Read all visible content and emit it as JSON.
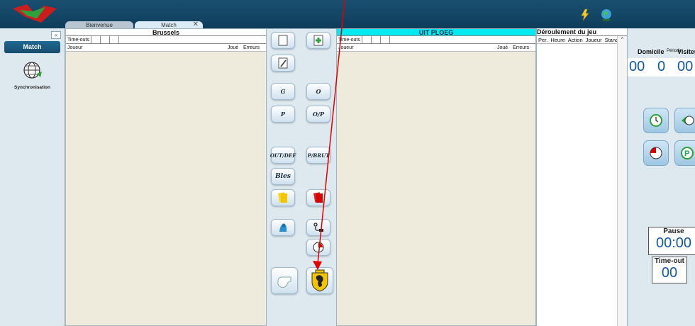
{
  "window": {
    "tabs": [
      {
        "label": "Bienvenue"
      },
      {
        "label": "Match",
        "close": "✕"
      }
    ],
    "top_icons": [
      "lightning-icon",
      "globe-icon"
    ]
  },
  "sidebar": {
    "collapse": "«",
    "active_item": "Match",
    "items": [
      {
        "label": "Synchronisation",
        "icon": "globe-sync-icon"
      }
    ]
  },
  "team_home": {
    "name": "Brussels",
    "timeouts_label": "Time-outs",
    "col_player": "Joueur",
    "col_played": "Joué",
    "col_errors": "Erreurs"
  },
  "team_away": {
    "name": "UIT PLOEG",
    "timeouts_label": "Time-outs",
    "col_player": "Joueur",
    "col_played": "Joué",
    "col_errors": "Erreurs",
    "accent": "#00eaf2"
  },
  "actions": {
    "g": "G",
    "o": "O",
    "p": "P",
    "op": "O/P",
    "outdef": "OUT/DEF",
    "pbrut": "P/BRUT",
    "bles": "Bles"
  },
  "events": {
    "title": "Déroulement du jeu",
    "columns": [
      "Per.",
      "Heure",
      "Action",
      "Joueur",
      "Stand"
    ]
  },
  "score": {
    "home_label": "Domicile",
    "period_label": "Période",
    "visitor_label": "Visiteur",
    "home": "00",
    "period": "0",
    "visitor": "00",
    "pause_label": "Pause",
    "pause_time": "00:00",
    "timeout_label": "Time-out",
    "timeout_value": "00"
  },
  "annotation": {
    "color": "#e00000"
  }
}
